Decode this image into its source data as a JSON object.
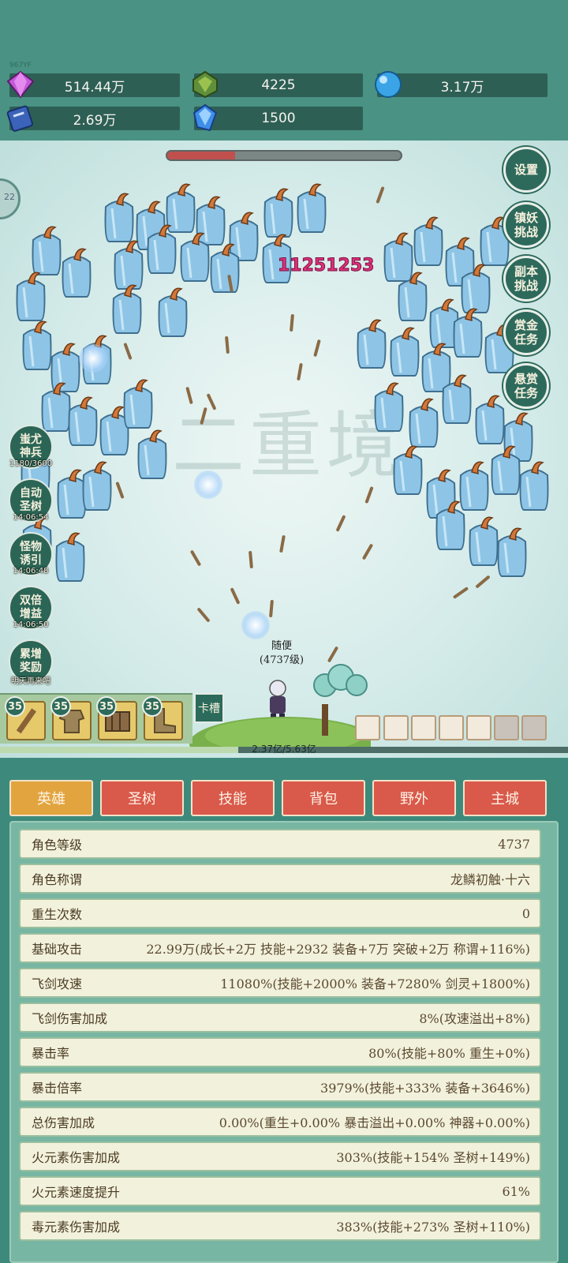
{
  "top_label": "967YF",
  "resources": [
    {
      "icon": "purple-gem-icon",
      "value": "514.44万"
    },
    {
      "icon": "green-crystal-icon",
      "value": "4225"
    },
    {
      "icon": "blue-orb-icon",
      "value": "3.17万"
    },
    {
      "icon": "blue-book-icon",
      "value": "2.69万"
    },
    {
      "icon": "blue-diamond-icon",
      "value": "1500"
    }
  ],
  "battle": {
    "boss_hp_fraction": 0.29,
    "damage_number": "11251253",
    "watermark": "二重境",
    "character_name": "随便",
    "character_level": "(4737级)",
    "exp_text": "2.37亿/5.63亿",
    "exp_fraction": 0.42,
    "edge_circle_text": "22"
  },
  "right_buttons": [
    "设置",
    "镇妖挑战",
    "副本挑战",
    "赏金任务",
    "悬赏任务"
  ],
  "left_buttons": [
    {
      "label": "蚩尤神兵",
      "sub": "1180/3600"
    },
    {
      "label": "自动圣树",
      "sub": "14:06:54"
    },
    {
      "label": "怪物诱引",
      "sub": "14:06:48"
    },
    {
      "label": "双倍增益",
      "sub": "14:06:50"
    },
    {
      "label": "累增奖励",
      "sub": "明天再来吧"
    }
  ],
  "equipment": [
    {
      "level": "35",
      "icon": "sword-icon"
    },
    {
      "level": "35",
      "icon": "armor-icon"
    },
    {
      "level": "35",
      "icon": "bracer-icon"
    },
    {
      "level": "35",
      "icon": "boots-icon"
    }
  ],
  "slot_button": "卡槽",
  "tabs": [
    "英雄",
    "圣树",
    "技能",
    "背包",
    "野外",
    "主城"
  ],
  "stats": [
    {
      "label": "角色等级",
      "value": "4737"
    },
    {
      "label": "角色称谓",
      "value": "龙鳞初触·十六"
    },
    {
      "label": "重生次数",
      "value": "0"
    },
    {
      "label": "基础攻击",
      "value": "22.99万(成长+2万 技能+2932 装备+7万 突破+2万 称谓+116%)"
    },
    {
      "label": "飞剑攻速",
      "value": "11080%(技能+2000% 装备+7280% 剑灵+1800%)"
    },
    {
      "label": "飞剑伤害加成",
      "value": "8%(攻速溢出+8%)"
    },
    {
      "label": "暴击率",
      "value": "80%(技能+80% 重生+0%)"
    },
    {
      "label": "暴击倍率",
      "value": "3979%(技能+333% 装备+3646%)"
    },
    {
      "label": "总伤害加成",
      "value": "0.00%(重生+0.00% 暴击溢出+0.00% 神器+0.00%)"
    },
    {
      "label": "火元素伤害加成",
      "value": "303%(技能+154% 圣树+149%)"
    },
    {
      "label": "火元素速度提升",
      "value": "61%"
    },
    {
      "label": "毒元素伤害加成",
      "value": "383%(技能+273% 圣树+110%)"
    }
  ]
}
